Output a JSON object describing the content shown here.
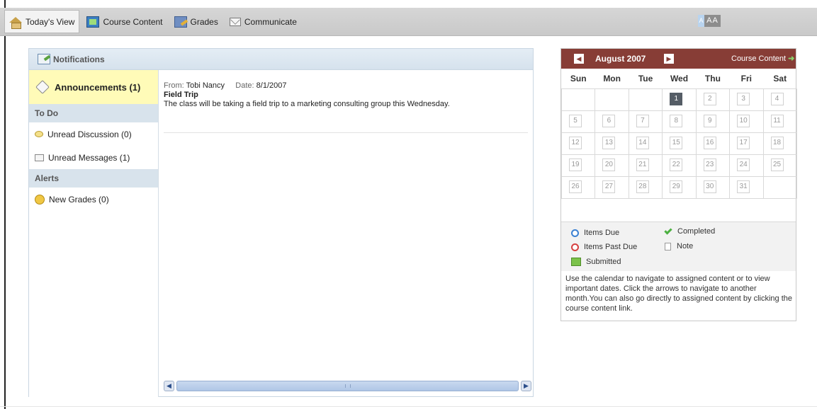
{
  "toolbar": {
    "items": [
      {
        "label": "Today's View",
        "icon": "home-icon",
        "active": true
      },
      {
        "label": "Course Content",
        "icon": "course-content-icon",
        "active": false
      },
      {
        "label": "Grades",
        "icon": "grades-icon",
        "active": false
      },
      {
        "label": "Communicate",
        "icon": "envelope-icon",
        "active": false
      }
    ],
    "font_size_small": "A",
    "font_size_large": "AA"
  },
  "notifications": {
    "title": "Notifications",
    "announcements_label": "Announcements (1)",
    "todo_header": "To Do",
    "todo_items": [
      {
        "label": "Unread Discussion (0)",
        "icon": "discussion-icon"
      },
      {
        "label": "Unread Messages (1)",
        "icon": "envelope-icon"
      }
    ],
    "alerts_header": "Alerts",
    "alert_items": [
      {
        "label": "New Grades (0)",
        "icon": "new-grades-icon"
      }
    ],
    "message": {
      "from_label": "From:",
      "from": "Tobi Nancy",
      "date_label": "Date:",
      "date": "8/1/2007",
      "title": "Field Trip",
      "body": "The class will be taking a field trip to a marketing consulting group this Wednesday."
    }
  },
  "calendar": {
    "month": "August 2007",
    "course_link": "Course Content",
    "weekdays": [
      "Sun",
      "Mon",
      "Tue",
      "Wed",
      "Thu",
      "Fri",
      "Sat"
    ],
    "today": "1",
    "weeks": [
      [
        "",
        "",
        "",
        "1",
        "2",
        "3",
        "4"
      ],
      [
        "5",
        "6",
        "7",
        "8",
        "9",
        "10",
        "11"
      ],
      [
        "12",
        "13",
        "14",
        "15",
        "16",
        "17",
        "18"
      ],
      [
        "19",
        "20",
        "21",
        "22",
        "23",
        "24",
        "25"
      ],
      [
        "26",
        "27",
        "28",
        "29",
        "30",
        "31",
        ""
      ]
    ],
    "legend": {
      "items_due": "Items Due",
      "items_past_due": "Items Past Due",
      "submitted": "Submitted",
      "completed": "Completed",
      "note": "Note"
    },
    "help_text": "Use the calendar to navigate to assigned content or to view important dates. Click the arrows to navigate to another month.You can also go directly to assigned content by clicking the course content link."
  }
}
